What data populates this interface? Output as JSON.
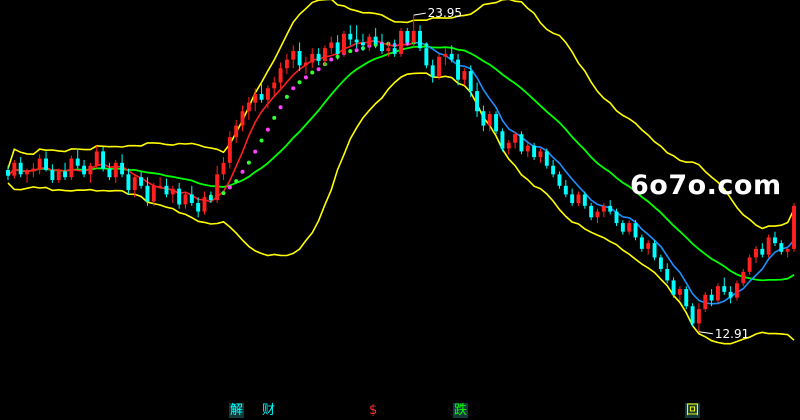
{
  "watermark": "6o7o.com",
  "annotations": {
    "high_label": "23.95",
    "low_label": "12.91"
  },
  "signals": [
    {
      "text": "解",
      "color": "#00ffff",
      "boxed": true
    },
    {
      "text": "财",
      "color": "#00ffff",
      "boxed": false
    },
    {
      "text": "$",
      "color": "#ff3030",
      "boxed": false
    },
    {
      "text": "跌",
      "color": "#00ff00",
      "boxed": true
    },
    {
      "text": "回",
      "color": "#ffff00",
      "boxed": true
    }
  ],
  "colors": {
    "background": "#000000",
    "up_candle": "#ff2020",
    "down_candle": "#00ffff",
    "band": "#ffff00",
    "middle_ma": "#00ff00",
    "trend_line_up": "#ff2020",
    "trend_line_down": "#1e90ff",
    "dot_line": "#ff40ff"
  },
  "chart_data": {
    "type": "candlestick",
    "y_domain": [
      10.6,
      24.2
    ],
    "high": 23.95,
    "low": 12.91,
    "candles": [
      [
        18.55,
        18.7,
        18.2,
        18.35
      ],
      [
        18.35,
        18.9,
        18.25,
        18.8
      ],
      [
        18.8,
        19.0,
        18.3,
        18.4
      ],
      [
        18.4,
        18.6,
        18.1,
        18.5
      ],
      [
        18.5,
        18.8,
        18.3,
        18.6
      ],
      [
        18.6,
        19.1,
        18.4,
        18.95
      ],
      [
        18.95,
        19.2,
        18.5,
        18.55
      ],
      [
        18.55,
        18.75,
        18.1,
        18.2
      ],
      [
        18.2,
        18.6,
        18.1,
        18.5
      ],
      [
        18.5,
        18.8,
        18.2,
        18.3
      ],
      [
        18.3,
        19.05,
        18.2,
        18.95
      ],
      [
        18.95,
        19.3,
        18.6,
        18.7
      ],
      [
        18.7,
        18.9,
        18.3,
        18.4
      ],
      [
        18.4,
        18.8,
        18.1,
        18.7
      ],
      [
        18.7,
        19.4,
        18.6,
        19.2
      ],
      [
        19.2,
        19.35,
        18.5,
        18.6
      ],
      [
        18.6,
        18.8,
        18.2,
        18.3
      ],
      [
        18.3,
        18.9,
        18.1,
        18.8
      ],
      [
        18.8,
        19.1,
        18.3,
        18.4
      ],
      [
        18.4,
        18.6,
        17.7,
        17.85
      ],
      [
        17.85,
        18.4,
        17.6,
        18.3
      ],
      [
        18.3,
        18.5,
        17.9,
        18.0
      ],
      [
        18.0,
        18.3,
        17.3,
        17.45
      ],
      [
        17.45,
        18.1,
        17.3,
        18.0
      ],
      [
        18.0,
        18.3,
        17.9,
        18.0
      ],
      [
        18.0,
        18.25,
        17.6,
        17.7
      ],
      [
        17.7,
        18.0,
        17.4,
        17.9
      ],
      [
        17.9,
        18.1,
        17.2,
        17.35
      ],
      [
        17.35,
        17.8,
        17.2,
        17.7
      ],
      [
        17.7,
        18.0,
        17.3,
        17.4
      ],
      [
        17.4,
        17.6,
        16.9,
        17.1
      ],
      [
        17.1,
        17.8,
        17.0,
        17.6
      ],
      [
        17.6,
        17.8,
        17.4,
        17.5
      ],
      [
        17.5,
        18.7,
        17.4,
        18.4
      ],
      [
        18.4,
        19.0,
        18.2,
        18.8
      ],
      [
        18.8,
        19.9,
        18.6,
        19.7
      ],
      [
        19.7,
        20.3,
        19.5,
        20.1
      ],
      [
        20.1,
        20.8,
        19.9,
        20.6
      ],
      [
        20.6,
        21.1,
        20.3,
        20.9
      ],
      [
        20.9,
        21.4,
        20.6,
        21.2
      ],
      [
        21.2,
        21.6,
        20.9,
        21.0
      ],
      [
        21.0,
        21.5,
        20.7,
        21.4
      ],
      [
        21.4,
        21.8,
        21.1,
        21.6
      ],
      [
        21.6,
        22.3,
        21.4,
        22.1
      ],
      [
        22.1,
        22.6,
        21.9,
        22.4
      ],
      [
        22.4,
        22.9,
        22.1,
        22.7
      ],
      [
        22.7,
        23.0,
        22.0,
        22.2
      ],
      [
        22.2,
        22.5,
        21.9,
        22.3
      ],
      [
        22.3,
        22.8,
        22.1,
        22.6
      ],
      [
        22.6,
        22.8,
        22.2,
        22.35
      ],
      [
        22.35,
        22.9,
        22.2,
        22.8
      ],
      [
        22.8,
        23.2,
        22.6,
        23.0
      ],
      [
        23.0,
        23.25,
        22.4,
        22.6
      ],
      [
        22.6,
        23.4,
        22.5,
        23.3
      ],
      [
        23.3,
        23.6,
        22.9,
        23.1
      ],
      [
        23.1,
        23.6,
        22.8,
        23.0
      ],
      [
        23.0,
        23.3,
        22.7,
        22.9
      ],
      [
        22.9,
        23.3,
        22.7,
        23.2
      ],
      [
        23.2,
        23.5,
        22.8,
        22.95
      ],
      [
        22.95,
        23.3,
        22.6,
        22.7
      ],
      [
        22.7,
        23.0,
        22.5,
        22.8
      ],
      [
        22.8,
        23.1,
        22.5,
        22.6
      ],
      [
        22.6,
        23.5,
        22.5,
        23.4
      ],
      [
        23.4,
        23.5,
        22.9,
        23.0
      ],
      [
        23.0,
        23.95,
        22.8,
        23.4
      ],
      [
        23.4,
        23.6,
        22.7,
        22.8
      ],
      [
        22.8,
        23.0,
        22.1,
        22.2
      ],
      [
        22.2,
        22.4,
        21.6,
        21.8
      ],
      [
        21.8,
        22.6,
        21.7,
        22.5
      ],
      [
        22.5,
        22.8,
        22.2,
        22.6
      ],
      [
        22.6,
        22.9,
        22.3,
        22.4
      ],
      [
        22.4,
        22.6,
        21.5,
        21.7
      ],
      [
        21.7,
        22.1,
        21.5,
        22.0
      ],
      [
        22.0,
        22.2,
        21.1,
        21.3
      ],
      [
        21.3,
        21.6,
        20.4,
        20.6
      ],
      [
        20.6,
        20.8,
        19.9,
        20.1
      ],
      [
        20.1,
        20.6,
        19.9,
        20.5
      ],
      [
        20.5,
        20.6,
        19.8,
        19.9
      ],
      [
        19.9,
        20.0,
        19.2,
        19.3
      ],
      [
        19.3,
        19.6,
        19.1,
        19.5
      ],
      [
        19.5,
        19.9,
        19.3,
        19.8
      ],
      [
        19.8,
        19.9,
        19.1,
        19.2
      ],
      [
        19.2,
        19.5,
        19.0,
        19.4
      ],
      [
        19.4,
        19.5,
        18.9,
        19.0
      ],
      [
        19.0,
        19.3,
        18.8,
        19.2
      ],
      [
        19.2,
        19.3,
        18.6,
        18.7
      ],
      [
        18.7,
        18.9,
        18.3,
        18.4
      ],
      [
        18.4,
        18.5,
        17.9,
        18.0
      ],
      [
        18.0,
        18.2,
        17.6,
        17.7
      ],
      [
        17.7,
        17.9,
        17.3,
        17.4
      ],
      [
        17.4,
        17.8,
        17.3,
        17.7
      ],
      [
        17.7,
        17.8,
        17.2,
        17.3
      ],
      [
        17.3,
        17.4,
        16.8,
        16.9
      ],
      [
        16.9,
        17.2,
        16.7,
        17.1
      ],
      [
        17.1,
        17.4,
        16.9,
        17.3
      ],
      [
        17.3,
        17.5,
        17.0,
        17.1
      ],
      [
        17.1,
        17.2,
        16.6,
        16.7
      ],
      [
        16.7,
        16.8,
        16.3,
        16.4
      ],
      [
        16.4,
        16.8,
        16.3,
        16.7
      ],
      [
        16.7,
        16.8,
        16.1,
        16.2
      ],
      [
        16.2,
        16.3,
        15.7,
        15.8
      ],
      [
        15.8,
        16.1,
        15.6,
        16.0
      ],
      [
        16.0,
        16.1,
        15.4,
        15.5
      ],
      [
        15.5,
        15.6,
        15.0,
        15.1
      ],
      [
        15.1,
        15.3,
        14.6,
        14.7
      ],
      [
        14.7,
        14.8,
        14.1,
        14.2
      ],
      [
        14.2,
        14.5,
        14.0,
        14.4
      ],
      [
        14.4,
        14.5,
        13.7,
        13.8
      ],
      [
        13.8,
        13.9,
        13.1,
        13.2
      ],
      [
        13.2,
        13.9,
        12.91,
        13.7
      ],
      [
        13.7,
        14.3,
        13.6,
        14.2
      ],
      [
        14.2,
        14.4,
        13.8,
        14.0
      ],
      [
        14.0,
        14.6,
        13.9,
        14.5
      ],
      [
        14.5,
        14.8,
        14.2,
        14.3
      ],
      [
        14.3,
        14.5,
        13.9,
        14.1
      ],
      [
        14.1,
        14.7,
        14.0,
        14.6
      ],
      [
        14.6,
        15.1,
        14.5,
        15.0
      ],
      [
        15.0,
        15.6,
        14.9,
        15.5
      ],
      [
        15.5,
        15.9,
        15.3,
        15.8
      ],
      [
        15.8,
        16.0,
        15.5,
        15.6
      ],
      [
        15.6,
        16.3,
        15.5,
        16.2
      ],
      [
        16.2,
        16.4,
        15.9,
        16.0
      ],
      [
        16.0,
        16.1,
        15.6,
        15.7
      ],
      [
        15.7,
        15.9,
        15.5,
        15.8
      ],
      [
        15.8,
        17.4,
        15.7,
        17.3
      ]
    ],
    "up_dash_index": 64,
    "low_index": 109
  }
}
